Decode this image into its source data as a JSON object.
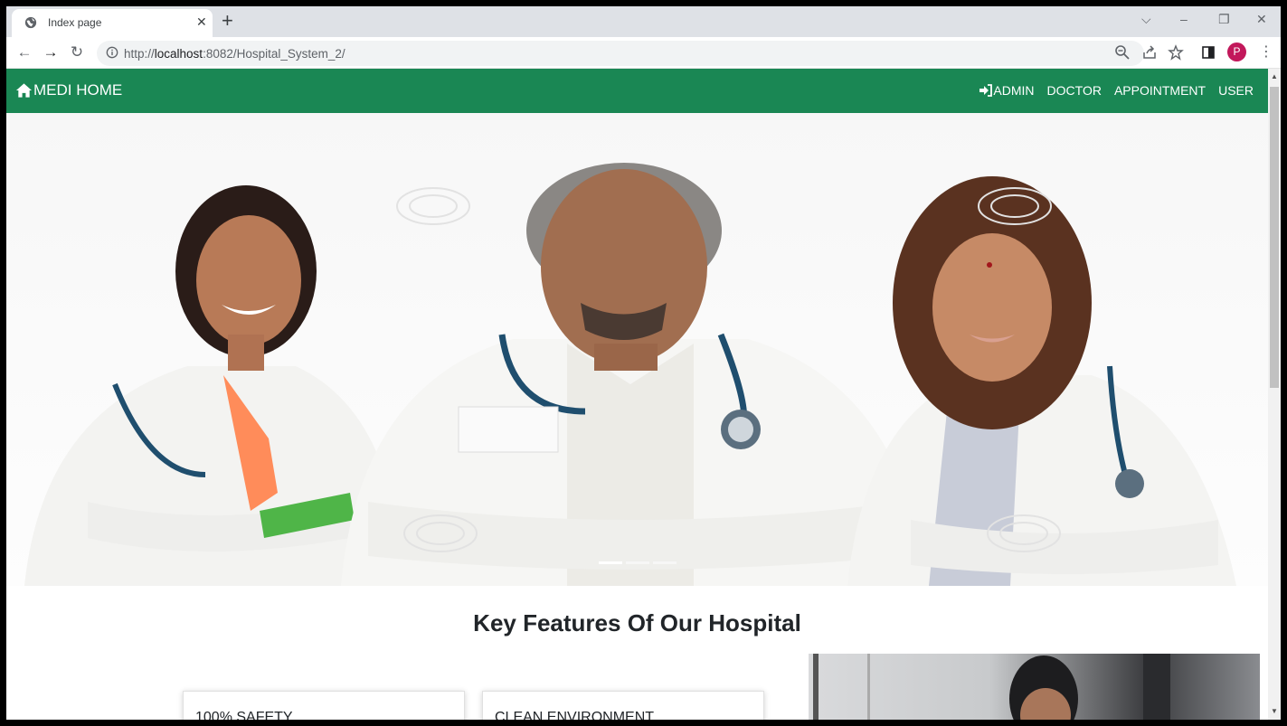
{
  "browser": {
    "tab_title": "Index page",
    "url_prefix": "http://",
    "url_host": "localhost",
    "url_rest": ":8082/Hospital_System_2/",
    "profile_initial": "P"
  },
  "navbar": {
    "brand": "MEDI HOME",
    "links": [
      "ADMIN",
      "DOCTOR",
      "APPOINTMENT",
      "USER"
    ],
    "color": "#1a8754"
  },
  "hero": {
    "slide_count": 3,
    "active_slide": 1
  },
  "features": {
    "title": "Key Features Of Our Hospital",
    "cards": [
      "100% SAFETY",
      "CLEAN ENVIRONMENT"
    ]
  }
}
